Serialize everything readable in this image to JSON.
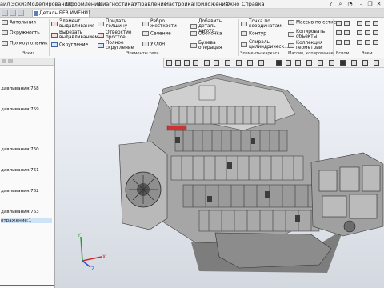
{
  "menu": {
    "items": [
      "айл",
      "Эскиз",
      "Моделирование",
      "Оформление",
      "Диагностика",
      "Управление",
      "Настройка",
      "Приложения",
      "Окно",
      "Справка"
    ]
  },
  "tab": {
    "document_title": "Деталь БЕЗ ИМЕНИ1"
  },
  "ribbon": {
    "col1": [
      "Автолиния",
      "Окружность",
      "Прямоугольник"
    ],
    "col2": [
      "Элемент выдавливания",
      "Вырезать выдавливанием",
      "Скругление"
    ],
    "col3": [
      "Придать толщину",
      "Отверстие простое",
      "Полное скругление"
    ],
    "col4": [
      "Ребро жесткости",
      "Сечение",
      "Уклон"
    ],
    "col5": [
      "Добавить деталь-загото...",
      "Оболочка",
      "Булева операция"
    ],
    "col6": [
      "Точка по координатам",
      "Контур",
      "Спираль цилиндрическ..."
    ],
    "col7": [
      "Массив по сетке",
      "Копировать объекты",
      "Коллекция геометрии"
    ],
    "groups": [
      "Эскиз",
      "Элементы тела",
      "Элементы каркаса",
      "Массив, копирование",
      "Вспом.",
      "Элем"
    ]
  },
  "tree": {
    "items": [
      {
        "label": "давливания:758",
        "selected": false
      },
      {
        "label": "давливания:759",
        "selected": false
      },
      {
        "label": "давливания:760",
        "selected": false
      },
      {
        "label": "давливания:761",
        "selected": false
      },
      {
        "label": "давливания:762",
        "selected": false
      },
      {
        "label": "давливания:763",
        "selected": false
      },
      {
        "label": "отражение:1",
        "selected": true
      }
    ]
  },
  "axes": {
    "x": "X",
    "y": "Y",
    "z": "Z"
  },
  "colors": {
    "accent": "#2c6ed5",
    "model_base": "#8e8e8e",
    "model_light": "#c7c7c7",
    "model_dark": "#3e3e3e"
  }
}
